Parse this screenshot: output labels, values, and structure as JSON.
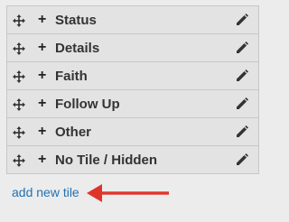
{
  "tiles": [
    {
      "label": "Status"
    },
    {
      "label": "Details"
    },
    {
      "label": "Faith"
    },
    {
      "label": "Follow Up"
    },
    {
      "label": "Other"
    },
    {
      "label": "No Tile / Hidden"
    }
  ],
  "icons": {
    "drag": "move-handle-icon",
    "expand": "plus-icon",
    "edit": "pencil-icon"
  },
  "expand_symbol": "+",
  "add_link": {
    "label": "add new tile"
  },
  "colors": {
    "link": "#2271b1",
    "arrow": "#e0342b",
    "row_bg": "#e3e3e3",
    "row_border": "#c7c7c7"
  }
}
